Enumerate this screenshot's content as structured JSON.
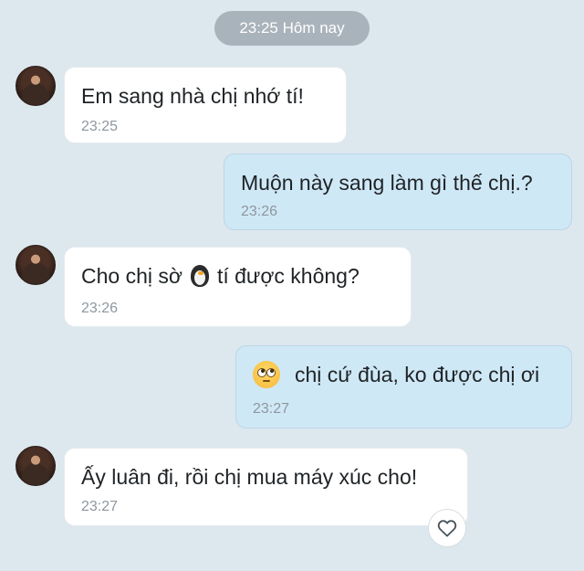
{
  "header": {
    "date_label": "23:25 Hôm nay"
  },
  "colors": {
    "incoming_bubble": "#ffffff",
    "outgoing_bubble": "#cfe8f6",
    "background": "#dde7ee"
  },
  "messages": [
    {
      "direction": "incoming",
      "text": "Em sang nhà chị nhớ tí!",
      "time": "23:25"
    },
    {
      "direction": "outgoing",
      "text": "Muộn này sang làm gì thế chị.?",
      "time": "23:26"
    },
    {
      "direction": "incoming",
      "text_before": "Cho chị sờ",
      "emoji": "penguin-emoji",
      "text_after": "tí được không?",
      "time": "23:26"
    },
    {
      "direction": "outgoing",
      "emoji": "rolling-eyes-emoji",
      "text": "chị cứ đùa, ko được chị ơi",
      "time": "23:27"
    },
    {
      "direction": "incoming",
      "text": "Ấy luân đi, rồi chị mua máy xúc cho!",
      "time": "23:27"
    }
  ],
  "reaction": {
    "icon": "heart-outline-icon"
  }
}
